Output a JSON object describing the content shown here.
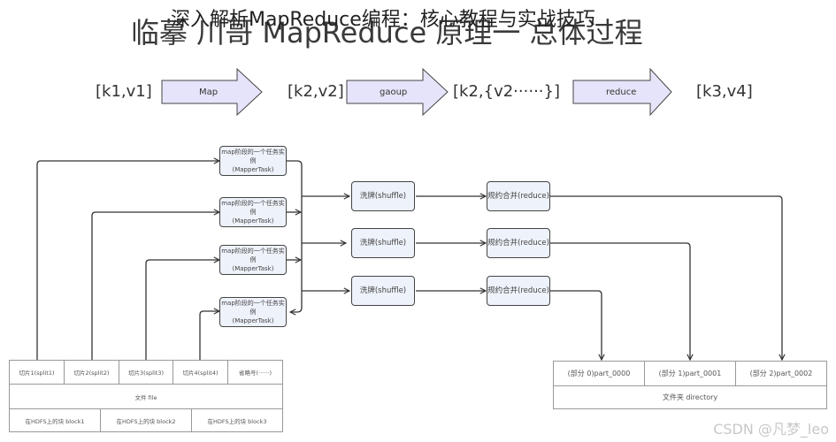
{
  "header": {
    "title": "临摹 川哥 MapReduce 原理一 总体过程",
    "overlay_title": "深入解析MapReduce编程：核心教程与实战技巧"
  },
  "flow": {
    "kv1": "[k1,v1]",
    "step1": "Map",
    "kv2": "[k2,v2]",
    "step2": "gaoup",
    "kv3": "[k2,{v2······}]",
    "step3": "reduce",
    "kv4": "[k3,v4]",
    "arrow_fill": "#e6e4fa"
  },
  "mappers": [
    {
      "line1": "map阶段的一个任务实例",
      "line2": "(MapperTask)"
    },
    {
      "line1": "map阶段的一个任务实例",
      "line2": "(MapperTask)"
    },
    {
      "line1": "map阶段的一个任务实例",
      "line2": "(MapperTask)"
    },
    {
      "line1": "map阶段的一个任务实例",
      "line2": "(MapperTask)"
    }
  ],
  "shuffles": [
    {
      "label": "洗牌(shuffle)"
    },
    {
      "label": "洗牌(shuffle)"
    },
    {
      "label": "洗牌(shuffle)"
    }
  ],
  "reduces": [
    {
      "label": "规约合并(reduce)"
    },
    {
      "label": "规约合并(reduce)"
    },
    {
      "label": "规约合并(reduce)"
    }
  ],
  "input_table": {
    "splits": [
      "切片1(split1)",
      "切片2(split2)",
      "切片3(split3)",
      "切片4(split4)",
      "省略号(······)"
    ],
    "file": "文件 file",
    "blocks": [
      "在HDFS上的块 block1",
      "在HDFS上的块 block2",
      "在HDFS上的块 block3"
    ]
  },
  "output_table": {
    "parts": [
      "(部分 0)part_0000",
      "(部分 1)part_0001",
      "(部分 2)part_0002"
    ],
    "directory": "文件夹 directory"
  },
  "watermark": "CSDN @凡梦_leo"
}
